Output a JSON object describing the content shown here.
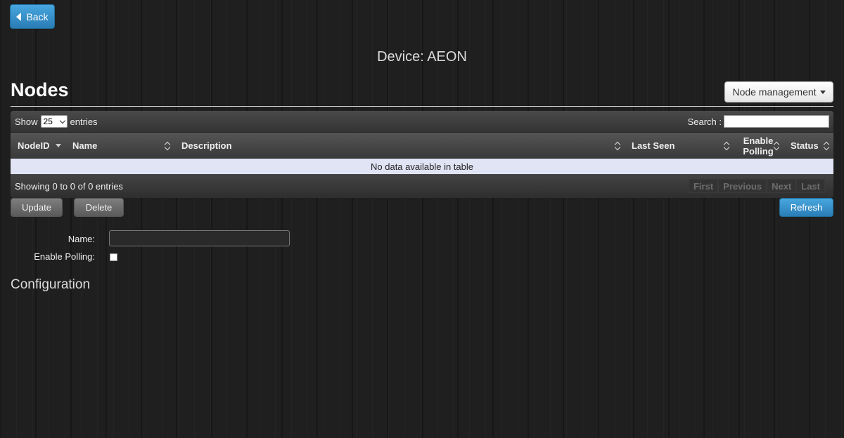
{
  "back_button": {
    "label": "Back"
  },
  "device_title": "Device: AEON",
  "nodes_heading": "Nodes",
  "node_management": {
    "label": "Node management"
  },
  "table": {
    "length_prefix": "Show",
    "length_value": "25",
    "length_suffix": "entries",
    "search_label": "Search :",
    "search_value": "",
    "columns": [
      {
        "label": "NodeID",
        "sort": "desc"
      },
      {
        "label": "Name",
        "sort": "both"
      },
      {
        "label": "Description",
        "sort": "both"
      },
      {
        "label": "Last Seen",
        "sort": "both"
      },
      {
        "label": "Enable Polling",
        "sort": "both"
      },
      {
        "label": "Status",
        "sort": "both"
      }
    ],
    "empty_message": "No data available in table",
    "info": "Showing 0 to 0 of 0 entries",
    "pagination": [
      "First",
      "Previous",
      "Next",
      "Last"
    ]
  },
  "actions": {
    "update": "Update",
    "delete": "Delete",
    "refresh": "Refresh"
  },
  "form": {
    "name_label": "Name:",
    "name_value": "",
    "polling_label": "Enable Polling:",
    "polling_checked": false
  },
  "configuration_heading": "Configuration",
  "colors": {
    "accent": "#2f87c4",
    "empty_row": "#e1e4f5"
  },
  "icons": {
    "back": "triangle-left-icon",
    "dropdown": "caret-down-icon"
  }
}
